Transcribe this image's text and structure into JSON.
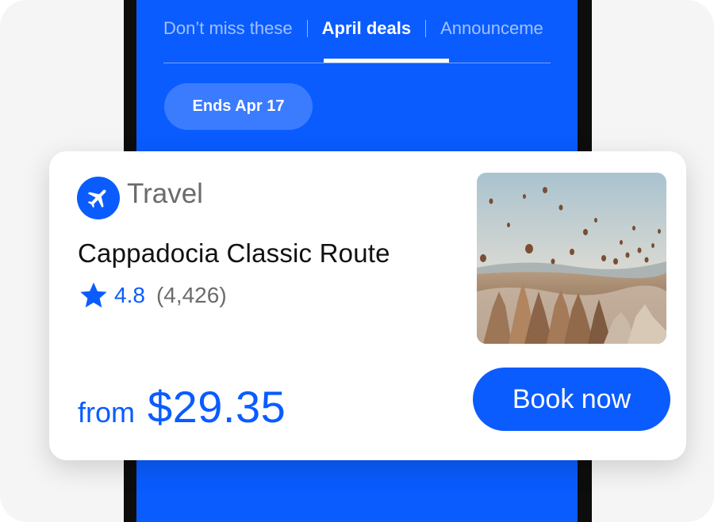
{
  "tabs": [
    {
      "label": "Don’t miss these",
      "active": false
    },
    {
      "label": "April deals",
      "active": true
    },
    {
      "label": "Announceme",
      "active": false
    }
  ],
  "promo_chip": "Ends Apr 17",
  "card": {
    "category_icon": "airplane-icon",
    "category": "Travel",
    "title": "Cappadocia Classic Route",
    "rating_icon": "star-icon",
    "rating": "4.8",
    "reviews": "(4,426)",
    "price_prefix": "from",
    "price": "$29.35",
    "book_label": "Book now"
  },
  "colors": {
    "accent": "#0a5cff",
    "phone_frame": "#0d0d0d",
    "muted_text": "#6b6b6b"
  }
}
